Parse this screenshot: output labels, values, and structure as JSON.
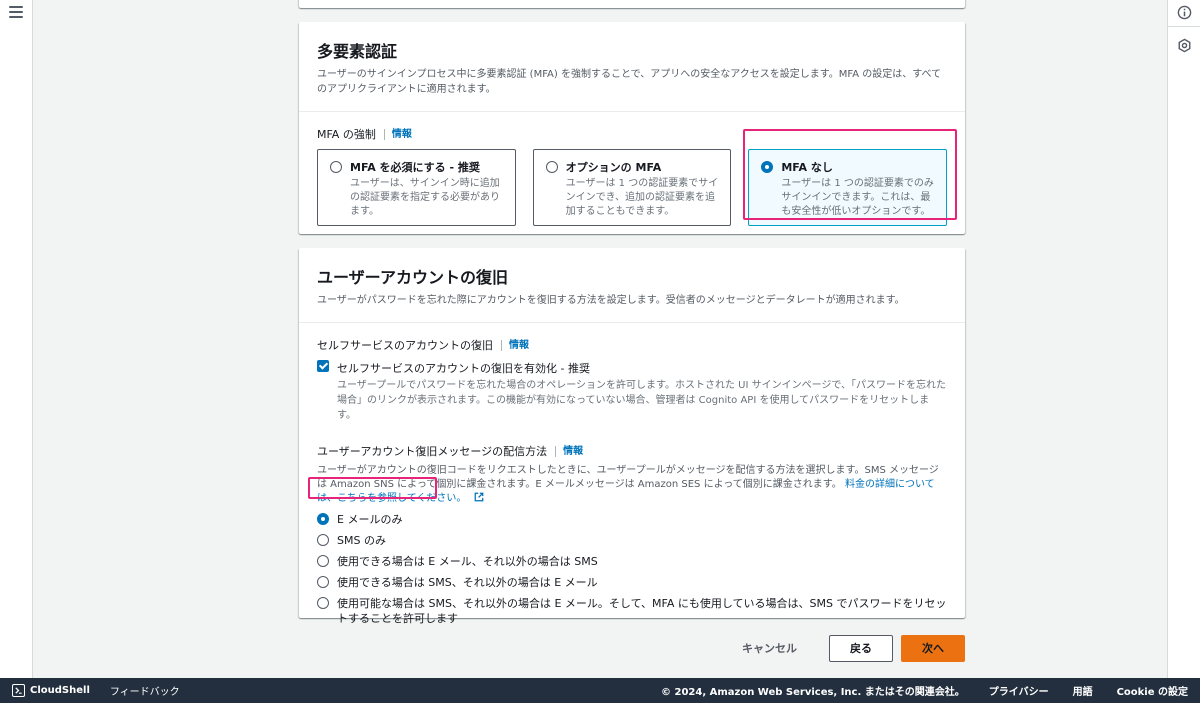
{
  "mfa": {
    "title": "多要素認証",
    "description": "ユーザーのサインインプロセス中に多要素認証 (MFA) を強制することで、アプリへの安全なアクセスを設定します。MFA の設定は、すべてのアプリクライアントに適用されます。",
    "enforcement_label": "MFA の強制",
    "info": "情報",
    "options": [
      {
        "label": "MFA を必須にする - 推奨",
        "description": "ユーザーは、サインイン時に追加の認証要素を指定する必要があります。",
        "selected": false
      },
      {
        "label": "オプションの MFA",
        "description": "ユーザーは 1 つの認証要素でサインインでき、追加の認証要素を追加することもできます。",
        "selected": false
      },
      {
        "label": "MFA なし",
        "description": "ユーザーは 1 つの認証要素でのみサインインできます。これは、最も安全性が低いオプションです。",
        "selected": true
      }
    ]
  },
  "recovery": {
    "title": "ユーザーアカウントの復旧",
    "description": "ユーザーがパスワードを忘れた際にアカウントを復旧する方法を設定します。受信者のメッセージとデータレートが適用されます。",
    "self_service_label": "セルフサービスのアカウントの復旧",
    "info": "情報",
    "checkbox_label": "セルフサービスのアカウントの復旧を有効化 - 推奨",
    "checkbox_desc": "ユーザープールでパスワードを忘れた場合のオペレーションを許可します。ホストされた UI サインインページで、「パスワードを忘れた場合」のリンクが表示されます。この機能が有効になっていない場合、管理者は Cognito API を使用してパスワードをリセットします。",
    "delivery_label": "ユーザーアカウント復旧メッセージの配信方法",
    "delivery_desc": "ユーザーがアカウントの復旧コードをリクエストしたときに、ユーザープールがメッセージを配信する方法を選択します。SMS メッセージは Amazon SNS によって個別に課金されます。E メールメッセージは Amazon SES によって個別に課金されます。",
    "pricing_link": "料金の詳細については、こちらを参照してください。",
    "options": [
      {
        "label": "E メールのみ",
        "selected": true
      },
      {
        "label": "SMS のみ",
        "selected": false
      },
      {
        "label": "使用できる場合は E メール、それ以外の場合は SMS",
        "selected": false
      },
      {
        "label": "使用できる場合は SMS、それ以外の場合は E メール",
        "selected": false
      },
      {
        "label": "使用可能な場合は SMS、それ以外の場合は E メール。そして、MFA にも使用している場合は、SMS でパスワードをリセットすることを許可します",
        "selected": false
      }
    ]
  },
  "actions": {
    "cancel": "キャンセル",
    "back": "戻る",
    "next": "次へ"
  },
  "footer": {
    "cloudshell": "CloudShell",
    "feedback": "フィードバック",
    "copyright": "© 2024, Amazon Web Services, Inc. またはその関連会社。",
    "privacy": "プライバシー",
    "terms": "用語",
    "cookie": "Cookie の設定"
  },
  "colors": {
    "highlight": "#e6247a",
    "primary": "#ec7211",
    "link": "#0073bb"
  }
}
